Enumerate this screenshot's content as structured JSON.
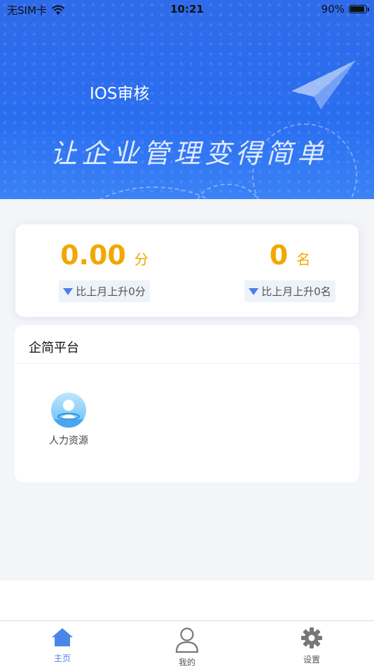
{
  "status_bar": {
    "carrier": "无SIM卡",
    "time": "10:21",
    "battery_percent": "90%",
    "battery_level": 0.9
  },
  "header": {
    "app_title": "IOS审核",
    "slogan": "让企业管理变得简单"
  },
  "stats": {
    "score": {
      "value": "0.00",
      "unit": "分",
      "change": "比上月上升0分"
    },
    "rank": {
      "value": "0",
      "unit": "名",
      "change": "比上月上升0名"
    }
  },
  "platform": {
    "title": "企简平台",
    "apps": [
      {
        "label": "人力资源",
        "icon": "user-circle-icon"
      }
    ]
  },
  "tabbar": {
    "items": [
      {
        "label": "主页",
        "icon": "home-icon",
        "active": true
      },
      {
        "label": "我的",
        "icon": "person-icon",
        "active": false
      },
      {
        "label": "设置",
        "icon": "gear-icon",
        "active": false
      }
    ]
  },
  "colors": {
    "hero_blue": "#2a6ef0",
    "accent_orange": "#f0a800",
    "tab_active": "#4a86e8",
    "tab_inactive": "#777777"
  }
}
